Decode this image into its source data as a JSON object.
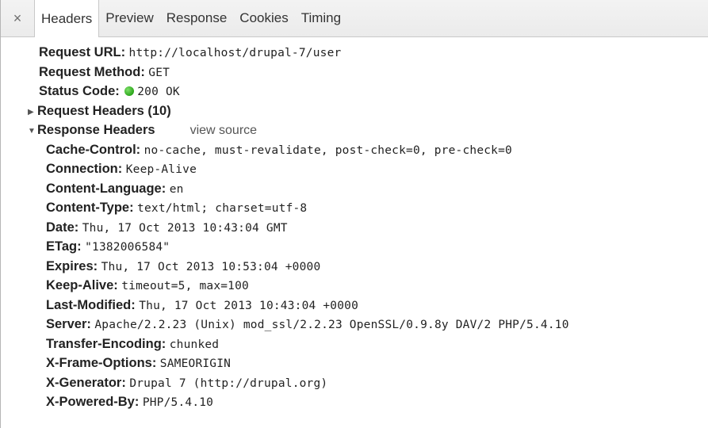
{
  "tabs": {
    "close_glyph": "×",
    "items": [
      {
        "label": "Headers"
      },
      {
        "label": "Preview"
      },
      {
        "label": "Response"
      },
      {
        "label": "Cookies"
      },
      {
        "label": "Timing"
      }
    ]
  },
  "general": {
    "request_url": {
      "key": "Request URL:",
      "value": "http://localhost/drupal-7/user"
    },
    "request_method": {
      "key": "Request Method:",
      "value": "GET"
    },
    "status_code": {
      "key": "Status Code:",
      "value": "200 OK",
      "status_color": "#2ba51a"
    }
  },
  "request_headers": {
    "title": "Request Headers (10)",
    "expanded": false
  },
  "response_headers": {
    "title": "Response Headers",
    "view_source": "view source",
    "expanded": true,
    "items": [
      {
        "key": "Cache-Control:",
        "value": "no-cache, must-revalidate, post-check=0, pre-check=0"
      },
      {
        "key": "Connection:",
        "value": "Keep-Alive"
      },
      {
        "key": "Content-Language:",
        "value": "en"
      },
      {
        "key": "Content-Type:",
        "value": "text/html; charset=utf-8"
      },
      {
        "key": "Date:",
        "value": "Thu, 17 Oct 2013 10:43:04 GMT"
      },
      {
        "key": "ETag:",
        "value": "\"1382006584\""
      },
      {
        "key": "Expires:",
        "value": "Thu, 17 Oct 2013 10:53:04 +0000"
      },
      {
        "key": "Keep-Alive:",
        "value": "timeout=5, max=100"
      },
      {
        "key": "Last-Modified:",
        "value": "Thu, 17 Oct 2013 10:43:04 +0000"
      },
      {
        "key": "Server:",
        "value": "Apache/2.2.23 (Unix) mod_ssl/2.2.23 OpenSSL/0.9.8y DAV/2 PHP/5.4.10"
      },
      {
        "key": "Transfer-Encoding:",
        "value": "chunked"
      },
      {
        "key": "X-Frame-Options:",
        "value": "SAMEORIGIN"
      },
      {
        "key": "X-Generator:",
        "value": "Drupal 7 (http://drupal.org)"
      },
      {
        "key": "X-Powered-By:",
        "value": "PHP/5.4.10"
      }
    ]
  }
}
